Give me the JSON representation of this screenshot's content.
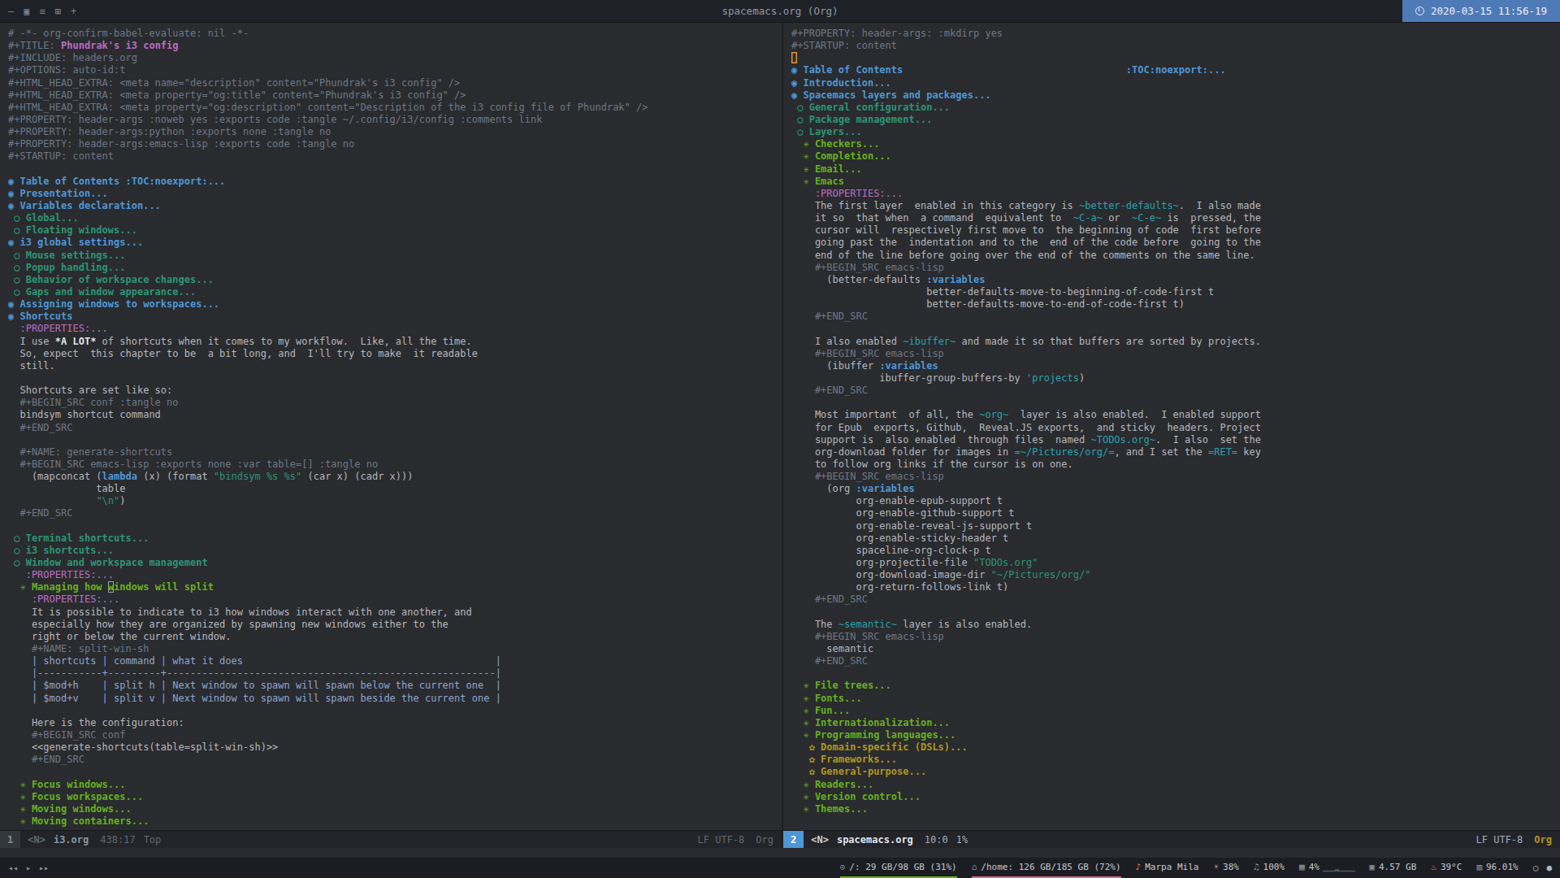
{
  "colors": {
    "background": "#292b2e",
    "headline1": "#4f97d7",
    "headline2": "#2d9574",
    "headline3": "#67b11d",
    "headline4": "#b1951d",
    "doc_title": "#bc6ec5",
    "string": "#2d9574",
    "inline_code": "#2aa1ae",
    "meta_line": "#6f7787",
    "cursor_active": "#e2943e",
    "modeline_active_chip": "#4f97d7",
    "datetime_bg": "#4e7ab8",
    "fs_root_underline": "#67b11d",
    "fs_home_underline": "#d3698c"
  },
  "titlebar": {
    "icons": [
      {
        "name": "minimize",
        "glyph": "–"
      },
      {
        "name": "layout",
        "glyph": "▣"
      },
      {
        "name": "menu",
        "glyph": "≡"
      },
      {
        "name": "grid",
        "glyph": "⊞"
      },
      {
        "name": "plus",
        "glyph": "+"
      }
    ],
    "title": "spacemacs.org (Org)",
    "datetime": "2020-03-15 11:56-19"
  },
  "windows": {
    "left": {
      "modeline": {
        "num": "1",
        "state": "<N>",
        "buffer": "i3.org",
        "pos": "438:17",
        "pct": "Top",
        "eol": "LF UTF-8",
        "mode": "Org"
      },
      "lines": [
        [
          [
            "meta",
            "# -*- org-confirm-babel-evaluate: nil -*-"
          ]
        ],
        [
          [
            "meta",
            "#+TITLE: "
          ],
          [
            "title",
            "Phundrak's i3 config"
          ]
        ],
        [
          [
            "meta",
            "#+INCLUDE: headers.org"
          ]
        ],
        [
          [
            "meta",
            "#+OPTIONS: auto-id:t"
          ]
        ],
        [
          [
            "meta",
            "#+HTML_HEAD_EXTRA: <meta name=\"description\" content=\"Phundrak's i3 config\" />"
          ]
        ],
        [
          [
            "meta",
            "#+HTML_HEAD_EXTRA: <meta property=\"og:title\" content=\"Phundrak's i3 config\" />"
          ]
        ],
        [
          [
            "meta",
            "#+HTML_HEAD_EXTRA: <meta property=\"og:description\" content=\"Description of the i3 config file of Phundrak\" />"
          ]
        ],
        [
          [
            "meta",
            "#+PROPERTY: header-args :noweb yes :exports code :tangle ~/.config/i3/config :comments link"
          ]
        ],
        [
          [
            "meta",
            "#+PROPERTY: header-args:python :exports none :tangle no"
          ]
        ],
        [
          [
            "meta",
            "#+PROPERTY: header-args:emacs-lisp :exports code :tangle no"
          ]
        ],
        [
          [
            "meta",
            "#+STARTUP: content"
          ]
        ],
        [],
        [
          [
            "h1",
            "◉ Table of Contents :TOC:noexport:..."
          ]
        ],
        [
          [
            "h1",
            "◉ Presentation..."
          ]
        ],
        [
          [
            "h1",
            "◉ Variables declaration..."
          ]
        ],
        [
          [
            "h2",
            " ○ Global..."
          ]
        ],
        [
          [
            "h2",
            " ○ Floating windows..."
          ]
        ],
        [
          [
            "h1",
            "◉ i3 global settings..."
          ]
        ],
        [
          [
            "h2",
            " ○ Mouse settings..."
          ]
        ],
        [
          [
            "h2",
            " ○ Popup handling..."
          ]
        ],
        [
          [
            "h2",
            " ○ Behavior of workspace changes..."
          ]
        ],
        [
          [
            "h2",
            " ○ Gaps and window appearance..."
          ]
        ],
        [
          [
            "h1",
            "◉ Assigning windows to workspaces..."
          ]
        ],
        [
          [
            "h1",
            "◉ Shortcuts"
          ]
        ],
        [
          [
            "drawer",
            "  :PROPERTIES:..."
          ]
        ],
        [
          [
            "body",
            "  I use "
          ],
          [
            "bold",
            "*A LOT*"
          ],
          [
            "body",
            " of shortcuts when it comes to my workflow.  Like, all the time."
          ]
        ],
        [
          [
            "body",
            "  So, expect  this chapter to be  a bit long, and  I'll try to make  it readable"
          ]
        ],
        [
          [
            "body",
            "  still."
          ]
        ],
        [],
        [
          [
            "body",
            "  Shortcuts are set like so:"
          ]
        ],
        [
          [
            "meta",
            "  #+BEGIN_SRC conf :tangle no"
          ]
        ],
        [
          [
            "src",
            "  bindsym shortcut command"
          ]
        ],
        [
          [
            "meta",
            "  #+END_SRC"
          ]
        ],
        [],
        [
          [
            "meta",
            "  #+NAME: generate-shortcuts"
          ]
        ],
        [
          [
            "meta",
            "  #+BEGIN_SRC emacs-lisp :exports none :var table=[] :tangle no"
          ]
        ],
        [
          [
            "src",
            "    (mapconcat ("
          ],
          [
            "kw",
            "lambda"
          ],
          [
            "src",
            " (x) (format "
          ],
          [
            "str",
            "\"bindsym %s %s\""
          ],
          [
            "src",
            " (car x) (cadr x)))"
          ]
        ],
        [
          [
            "src",
            "               table"
          ]
        ],
        [
          [
            "src",
            "               "
          ],
          [
            "str",
            "\"\\n\""
          ],
          [
            "src",
            ")"
          ]
        ],
        [
          [
            "meta",
            "  #+END_SRC"
          ]
        ],
        [],
        [
          [
            "h2",
            " ○ Terminal shortcuts..."
          ]
        ],
        [
          [
            "h2",
            " ○ i3 shortcuts..."
          ]
        ],
        [
          [
            "h2",
            " ○ Window and workspace management"
          ]
        ],
        [
          [
            "drawer",
            "   :PROPERTIES:..."
          ]
        ],
        [
          [
            "h3",
            "  ✳ Managing how "
          ],
          [
            "h3 cur-i",
            "w"
          ],
          [
            "h3",
            "indows will split"
          ]
        ],
        [
          [
            "drawer",
            "    :PROPERTIES:..."
          ]
        ],
        [
          [
            "body",
            "    It is possible to indicate to i3 how windows interact with one another, and"
          ]
        ],
        [
          [
            "body",
            "    especially how they are organized by spawning new windows either to the"
          ]
        ],
        [
          [
            "body",
            "    right or below the current window."
          ]
        ],
        [
          [
            "meta",
            "    #+NAME: split-win-sh"
          ]
        ],
        [
          [
            "table",
            "    | shortcuts | command | what it does                                           |"
          ]
        ],
        [
          [
            "table",
            "    |-----------+---------+--------------------------------------------------------|"
          ]
        ],
        [
          [
            "table",
            "    | $mod+h    | split h | Next window to spawn will spawn below the current one  |"
          ]
        ],
        [
          [
            "table",
            "    | $mod+v    | split v | Next window to spawn will spawn beside the current one |"
          ]
        ],
        [],
        [
          [
            "body",
            "    Here is the configuration:"
          ]
        ],
        [
          [
            "meta",
            "    #+BEGIN_SRC conf"
          ]
        ],
        [
          [
            "src",
            "    <<generate-shortcuts(table=split-win-sh)>>"
          ]
        ],
        [
          [
            "meta",
            "    #+END_SRC"
          ]
        ],
        [],
        [
          [
            "h3",
            "  ✳ Focus windows..."
          ]
        ],
        [
          [
            "h3",
            "  ✳ Focus workspaces..."
          ]
        ],
        [
          [
            "h3",
            "  ✳ Moving windows..."
          ]
        ],
        [
          [
            "h3",
            "  ✳ Moving containers..."
          ]
        ]
      ]
    },
    "right": {
      "modeline": {
        "num": "2",
        "state": "<N>",
        "buffer": "spacemacs.org",
        "pos": "10:0",
        "pct": "1%",
        "eol": "LF UTF-8",
        "mode": "Org"
      },
      "lines": [
        [
          [
            "meta",
            "#+PROPERTY: header-args: :mkdirp yes"
          ]
        ],
        [
          [
            "meta",
            "#+STARTUP: content"
          ]
        ],
        [
          [
            "cur-a",
            " "
          ]
        ],
        [
          [
            "h1",
            "◉ Table of Contents                                      :TOC:noexport:..."
          ]
        ],
        [
          [
            "h1",
            "◉ Introduction..."
          ]
        ],
        [
          [
            "h1",
            "◉ Spacemacs layers and packages..."
          ]
        ],
        [
          [
            "h2",
            " ○ General configuration..."
          ]
        ],
        [
          [
            "h2",
            " ○ Package management..."
          ]
        ],
        [
          [
            "h2",
            " ○ Layers..."
          ]
        ],
        [
          [
            "h3",
            "  ✳ Checkers..."
          ]
        ],
        [
          [
            "h3",
            "  ✳ Completion..."
          ]
        ],
        [
          [
            "h3",
            "  ✳ Email..."
          ]
        ],
        [
          [
            "h3",
            "  ✳ Emacs"
          ]
        ],
        [
          [
            "drawer",
            "    :PROPERTIES:..."
          ]
        ],
        [
          [
            "body",
            "    The first layer  enabled in this category is "
          ],
          [
            "code",
            "~better-defaults~"
          ],
          [
            "body",
            ".  I also made"
          ]
        ],
        [
          [
            "body",
            "    it so  that when  a command  equivalent to  "
          ],
          [
            "code",
            "~C-a~"
          ],
          [
            "body",
            " or  "
          ],
          [
            "code",
            "~C-e~"
          ],
          [
            "body",
            " is  pressed, the"
          ]
        ],
        [
          [
            "body",
            "    cursor will  respectively first move to  the beginning of code  first before"
          ]
        ],
        [
          [
            "body",
            "    going past the  indentation and to the  end of the code before  going to the"
          ]
        ],
        [
          [
            "body",
            "    end of the line before going over the end of the comments on the same line."
          ]
        ],
        [
          [
            "meta",
            "    #+BEGIN_SRC emacs-lisp"
          ]
        ],
        [
          [
            "src",
            "      (better-defaults "
          ],
          [
            "kw",
            ":variables"
          ]
        ],
        [
          [
            "src",
            "                       better-defaults-move-to-beginning-of-code-first t"
          ]
        ],
        [
          [
            "src",
            "                       better-defaults-move-to-end-of-code-first t)"
          ]
        ],
        [
          [
            "meta",
            "    #+END_SRC"
          ]
        ],
        [],
        [
          [
            "body",
            "    I also enabled "
          ],
          [
            "code",
            "~ibuffer~"
          ],
          [
            "body",
            " and made it so that buffers are sorted by projects."
          ]
        ],
        [
          [
            "meta",
            "    #+BEGIN_SRC emacs-lisp"
          ]
        ],
        [
          [
            "src",
            "      (ibuffer "
          ],
          [
            "kw",
            ":variables"
          ]
        ],
        [
          [
            "src",
            "               ibuffer-group-buffers-by "
          ],
          [
            "code",
            "'projects"
          ],
          [
            "src",
            ")"
          ]
        ],
        [
          [
            "meta",
            "    #+END_SRC"
          ]
        ],
        [],
        [
          [
            "body",
            "    Most important  of all, the "
          ],
          [
            "code",
            "~org~"
          ],
          [
            "body",
            "  layer is also enabled.  I enabled support"
          ]
        ],
        [
          [
            "body",
            "    for Epub  exports, Github,  Reveal.JS exports,  and sticky  headers. Project"
          ]
        ],
        [
          [
            "body",
            "    support is  also enabled  through files  named "
          ],
          [
            "code",
            "~TODOs.org~"
          ],
          [
            "body",
            ".  I also  set the"
          ]
        ],
        [
          [
            "body",
            "    org-download folder for images in "
          ],
          [
            "code",
            "=~/Pictures/org/="
          ],
          [
            "body",
            ", and I set the "
          ],
          [
            "code",
            "=RET="
          ],
          [
            "body",
            " key"
          ]
        ],
        [
          [
            "body",
            "    to follow org links if the cursor is on one."
          ]
        ],
        [
          [
            "meta",
            "    #+BEGIN_SRC emacs-lisp"
          ]
        ],
        [
          [
            "src",
            "      (org "
          ],
          [
            "kw",
            ":variables"
          ]
        ],
        [
          [
            "src",
            "           org-enable-epub-support t"
          ]
        ],
        [
          [
            "src",
            "           org-enable-github-support t"
          ]
        ],
        [
          [
            "src",
            "           org-enable-reveal-js-support t"
          ]
        ],
        [
          [
            "src",
            "           org-enable-sticky-header t"
          ]
        ],
        [
          [
            "src",
            "           spaceline-org-clock-p t"
          ]
        ],
        [
          [
            "src",
            "           org-projectile-file "
          ],
          [
            "str",
            "\"TODOs.org\""
          ]
        ],
        [
          [
            "src",
            "           org-download-image-dir "
          ],
          [
            "str",
            "\"~/Pictures/org/\""
          ]
        ],
        [
          [
            "src",
            "           org-return-follows-link t)"
          ]
        ],
        [
          [
            "meta",
            "    #+END_SRC"
          ]
        ],
        [],
        [
          [
            "body",
            "    The "
          ],
          [
            "code",
            "~semantic~"
          ],
          [
            "body",
            " layer is also enabled."
          ]
        ],
        [
          [
            "meta",
            "    #+BEGIN_SRC emacs-lisp"
          ]
        ],
        [
          [
            "src",
            "      semantic"
          ]
        ],
        [
          [
            "meta",
            "    #+END_SRC"
          ]
        ],
        [],
        [
          [
            "h3",
            "  ✳ File trees..."
          ]
        ],
        [
          [
            "h3",
            "  ✳ Fonts..."
          ]
        ],
        [
          [
            "h3",
            "  ✳ Fun..."
          ]
        ],
        [
          [
            "h3",
            "  ✳ Internationalization..."
          ]
        ],
        [
          [
            "h3",
            "  ✳ Programming languages..."
          ]
        ],
        [
          [
            "h4",
            "   ✿ Domain-specific (DSLs)..."
          ]
        ],
        [
          [
            "h4",
            "   ✿ Frameworks..."
          ]
        ],
        [
          [
            "h4",
            "   ✿ General-purpose..."
          ]
        ],
        [
          [
            "h3",
            "  ✳ Readers..."
          ]
        ],
        [
          [
            "h3",
            "  ✳ Version control..."
          ]
        ],
        [
          [
            "h3",
            "  ✳ Themes..."
          ]
        ]
      ]
    }
  },
  "statusbar": {
    "player": [
      {
        "name": "previous",
        "glyph": "◂◂"
      },
      {
        "name": "play",
        "glyph": "▸"
      },
      {
        "name": "next",
        "glyph": "▸▸"
      }
    ],
    "modules": [
      {
        "name": "fs-root",
        "icon": "⊙",
        "text": "/: 29 GB/98 GB (31%)",
        "underline": "#67b11d"
      },
      {
        "name": "fs-home",
        "icon": "⌂",
        "text": "/home: 126 GB/185 GB (72%)",
        "underline": "#d3698c"
      },
      {
        "name": "mpd-song",
        "icon": "♪",
        "icon_color": "#e5894f",
        "text": "Marpa Mila"
      },
      {
        "name": "brightness",
        "icon": "☀",
        "text": "38%"
      },
      {
        "name": "volume",
        "icon": "♫",
        "text": "100%"
      },
      {
        "name": "cpu",
        "icon": "▦",
        "text": "4%",
        "spark": "▁▁▁▂▁▁▁▁"
      },
      {
        "name": "memory",
        "icon": "▣",
        "text": "4.57 GB"
      },
      {
        "name": "temperature",
        "icon": "♨",
        "icon_color": "#e5894f",
        "text": "39°C"
      },
      {
        "name": "ram",
        "icon": "▥",
        "text": "96.01%"
      }
    ],
    "tray": [
      {
        "name": "tray-circle",
        "glyph": "○"
      },
      {
        "name": "tray-dot",
        "glyph": "●"
      }
    ]
  }
}
